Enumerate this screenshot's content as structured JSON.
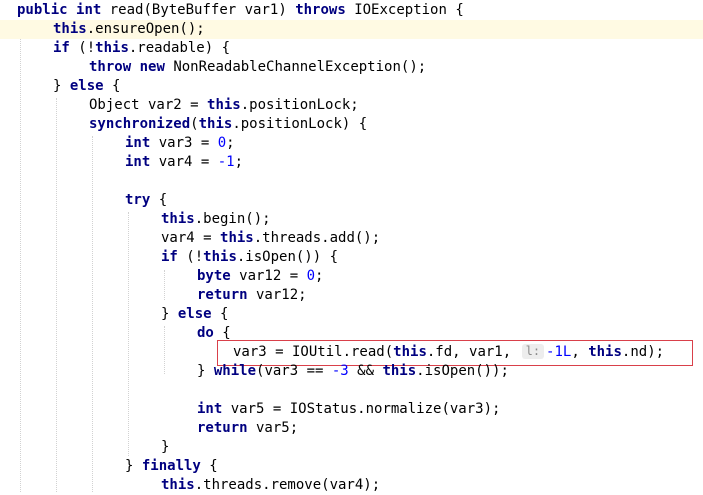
{
  "code": {
    "line_01": {
      "kw_public": "public",
      "kw_int": "int",
      "rest": " read(ByteBuffer var1) ",
      "kw_throws": "throws",
      "tail": " IOException {"
    },
    "line_02": {
      "kw_this": "this",
      "rest": ".ensureOpen();"
    },
    "line_03": {
      "kw_if": "if",
      "mid": " (!",
      "kw_this": "this",
      "rest": ".readable) {"
    },
    "line_04": {
      "kw_throw": "throw",
      "kw_new": "new",
      "rest": " NonReadableChannelException();"
    },
    "line_05": {
      "head": "} ",
      "kw_else": "else",
      "rest": " {"
    },
    "line_06": {
      "head": "Object var2 = ",
      "kw_this": "this",
      "rest": ".positionLock;"
    },
    "line_07": {
      "kw_synchronized": "synchronized",
      "mid": "(",
      "kw_this": "this",
      "rest": ".positionLock) {"
    },
    "line_08": {
      "kw_int": "int",
      "mid": " var3 = ",
      "num": "0",
      "rest": ";"
    },
    "line_09": {
      "kw_int": "int",
      "mid": " var4 = ",
      "num": "-1",
      "rest": ";"
    },
    "line_10": {
      "kw_try": "try",
      "rest": " {"
    },
    "line_11": {
      "kw_this": "this",
      "rest": ".begin();"
    },
    "line_12": {
      "head": "var4 = ",
      "kw_this": "this",
      "rest": ".threads.add();"
    },
    "line_13": {
      "kw_if": "if",
      "mid": " (!",
      "kw_this": "this",
      "rest": ".isOpen()) {"
    },
    "line_14": {
      "kw_byte": "byte",
      "mid": " var12 = ",
      "num": "0",
      "rest": ";"
    },
    "line_15": {
      "kw_return": "return",
      "rest": " var12;"
    },
    "line_16": {
      "head": "} ",
      "kw_else": "else",
      "rest": " {"
    },
    "line_17": {
      "kw_do": "do",
      "rest": " {"
    },
    "line_18": {
      "head": "var3 = IOUtil.read(",
      "kw_this1": "this",
      "mid1": ".fd, var1, ",
      "hint": "l:",
      "num": "-1L",
      "mid2": ", ",
      "kw_this2": "this",
      "rest": ".nd);"
    },
    "line_19": {
      "head": "} ",
      "kw_while": "while",
      "mid1": "(var3 == ",
      "num": "-3",
      "mid2": " && ",
      "kw_this": "this",
      "rest": ".isOpen());"
    },
    "line_20": {
      "kw_int": "int",
      "rest": " var5 = IOStatus.normalize(var3);"
    },
    "line_21": {
      "kw_return": "return",
      "rest": " var5;"
    },
    "line_22": {
      "head": "}"
    },
    "line_23": {
      "head": "} ",
      "kw_finally": "finally",
      "rest": " {"
    },
    "line_24": {
      "kw_this": "this",
      "rest": ".threads.remove(var4);"
    }
  },
  "colors": {
    "keyword": "#000080",
    "number": "#0000ff",
    "highlight_border": "#d9404a",
    "current_line": "#fffae3"
  }
}
